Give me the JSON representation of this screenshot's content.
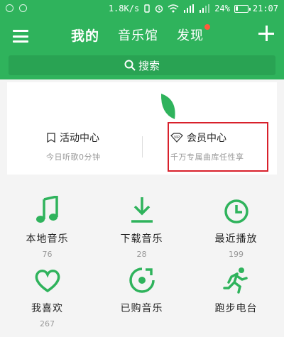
{
  "status": {
    "speed": "1.8K/s",
    "battery_pct": "24%",
    "battery_level": 0.24,
    "time": "21:07",
    "signal_tags": [
      "4G",
      "2G"
    ]
  },
  "nav": {
    "tabs": [
      {
        "label": "我的",
        "active": true
      },
      {
        "label": "音乐馆",
        "active": false
      },
      {
        "label": "发现",
        "active": false,
        "badge": true
      }
    ]
  },
  "search": {
    "placeholder": "搜索"
  },
  "promo": {
    "activity": {
      "title": "活动中心",
      "sub": "今日听歌0分钟"
    },
    "vip": {
      "title": "会员中心",
      "sub": "千万专属曲库任性享",
      "badge": "VIP"
    }
  },
  "grid": [
    {
      "label": "本地音乐",
      "count": "76",
      "icon": "music-note-icon"
    },
    {
      "label": "下载音乐",
      "count": "28",
      "icon": "download-icon"
    },
    {
      "label": "最近播放",
      "count": "199",
      "icon": "clock-icon"
    },
    {
      "label": "我喜欢",
      "count": "267",
      "icon": "heart-icon"
    },
    {
      "label": "已购音乐",
      "count": "",
      "icon": "purchased-disc-icon"
    },
    {
      "label": "跑步电台",
      "count": "",
      "icon": "running-icon"
    }
  ],
  "colors": {
    "brand": "#2fb35c",
    "accent": "#ff5a3c",
    "highlight": "#d8202b"
  }
}
